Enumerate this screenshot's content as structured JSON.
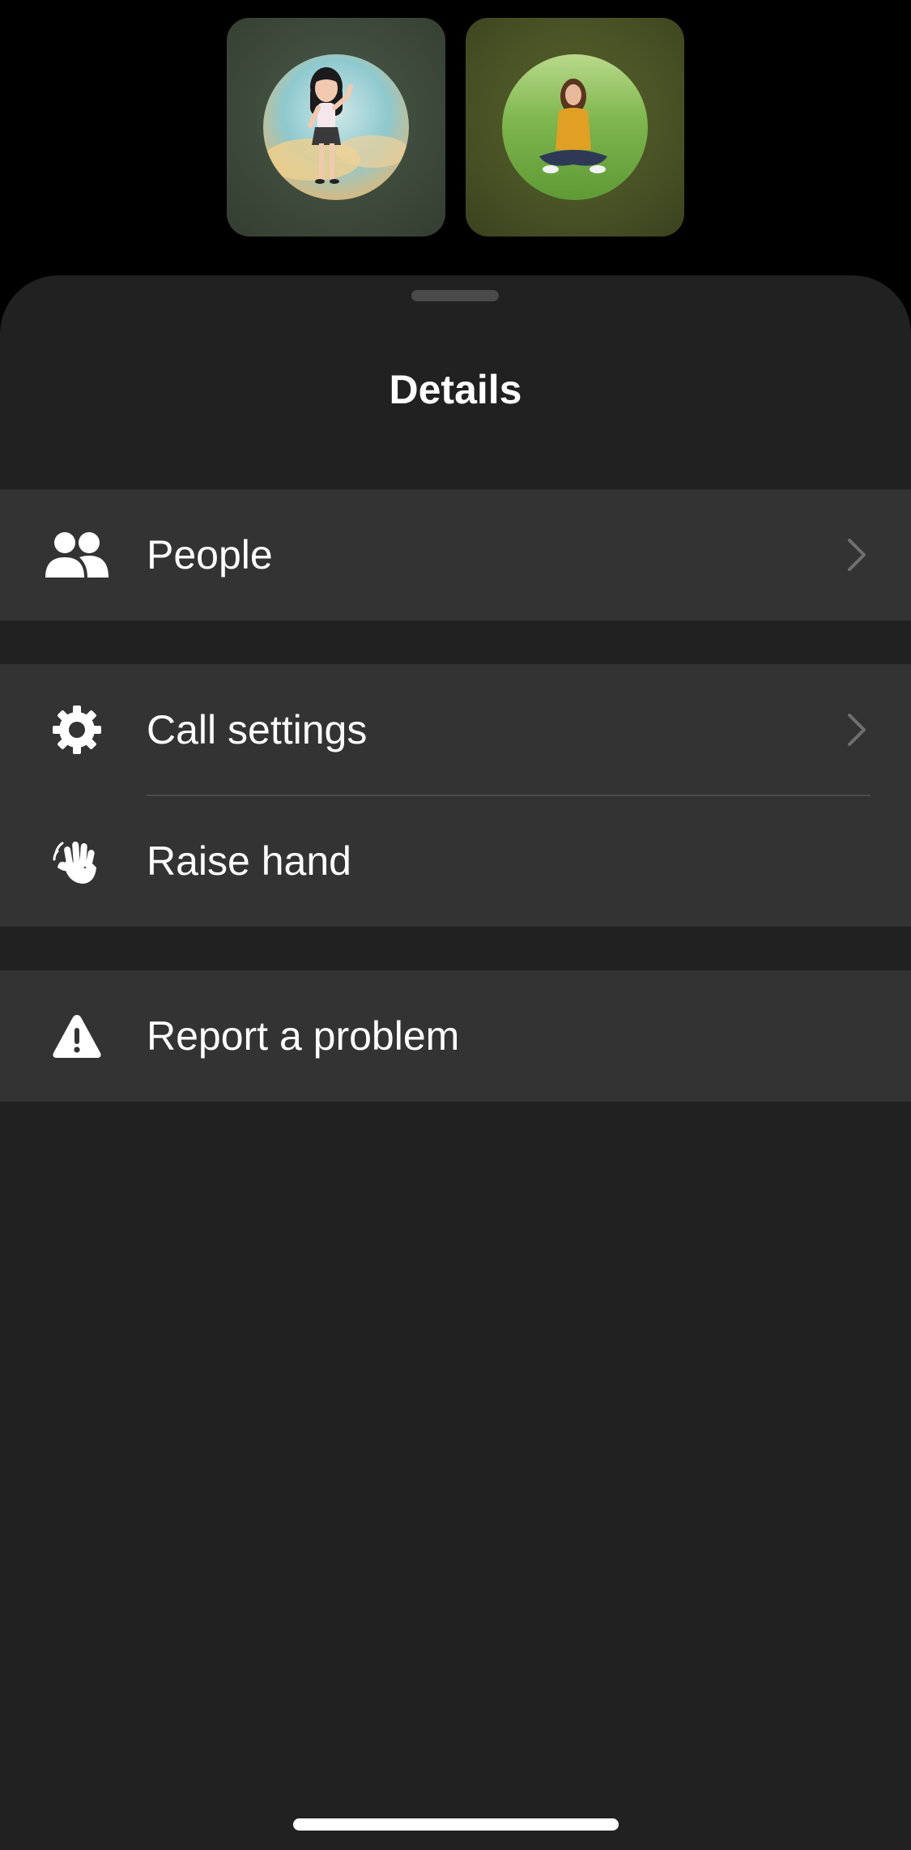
{
  "participants": [
    {
      "name": "participant-avatar-1",
      "kind": "memoji-avatar"
    },
    {
      "name": "participant-avatar-2",
      "kind": "photo-avatar"
    }
  ],
  "sheet": {
    "title": "Details"
  },
  "menu": {
    "people": {
      "label": "People",
      "icon": "people-icon",
      "has_chevron": true
    },
    "call_settings": {
      "label": "Call settings",
      "icon": "gear-icon",
      "has_chevron": true
    },
    "raise_hand": {
      "label": "Raise hand",
      "icon": "waving-hand-icon",
      "has_chevron": false
    },
    "report_problem": {
      "label": "Report a problem",
      "icon": "warning-icon",
      "has_chevron": false
    }
  },
  "colors": {
    "background": "#000000",
    "sheet": "#212121",
    "row": "#333333",
    "text": "#ffffff",
    "chevron": "#6f6f6f"
  }
}
